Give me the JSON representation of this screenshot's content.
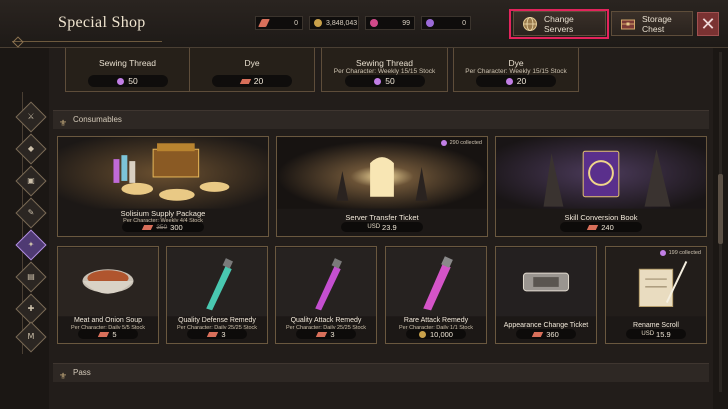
{
  "header": {
    "title": "Special Shop",
    "currencies": [
      {
        "icon": "red-gem-icon",
        "value": "0",
        "color": "#d86f5a"
      },
      {
        "icon": "gold-coin-icon",
        "value": "3,848,043",
        "color": "#c9a14a"
      },
      {
        "icon": "pink-gem-icon",
        "value": "99",
        "color": "#d24a8a"
      },
      {
        "icon": "purple-orb-icon",
        "value": "0",
        "color": "#9b6ad8"
      }
    ],
    "change_servers_label": "Change Servers",
    "storage_chest_label": "Storage Chest"
  },
  "top_row": [
    {
      "name": "Sewing Thread",
      "sub": "",
      "price": "50",
      "currency": "pink-orb"
    },
    {
      "name": "Dye",
      "sub": "",
      "price": "20",
      "currency": "red-gem"
    },
    {
      "name": "Sewing Thread",
      "sub": "Per Character:  Weekly 15/15 Stock",
      "price": "50",
      "currency": "pink-orb"
    },
    {
      "name": "Dye",
      "sub": "Per Character:  Weekly 15/15 Stock",
      "price": "20",
      "currency": "pink-orb"
    }
  ],
  "sections": {
    "consumables": "Consumables",
    "pass": "Pass"
  },
  "consumables_row1": [
    {
      "name": "Solisium Supply Package",
      "sub": "Per Character:  Weekly 4/4 Stock",
      "old_price": "350",
      "price": "300",
      "currency": "red-gem"
    },
    {
      "name": "Server Transfer Ticket",
      "sub": "",
      "collected": "290 collected",
      "unit": "USD",
      "price": "23.9"
    },
    {
      "name": "Skill Conversion Book",
      "sub": "",
      "price": "240",
      "currency": "red-gem"
    }
  ],
  "consumables_row2": [
    {
      "name": "Meat and Onion Soup",
      "sub": "Per Character:  Daily 5/5 Stock",
      "price": "5",
      "currency": "red-gem"
    },
    {
      "name": "Quality Defense Remedy",
      "sub": "Per Character:  Daily 25/25 Stock",
      "price": "3",
      "currency": "red-gem"
    },
    {
      "name": "Quality Attack Remedy",
      "sub": "Per Character:  Daily 25/25 Stock",
      "price": "3",
      "currency": "red-gem"
    },
    {
      "name": "Rare Attack Remedy",
      "sub": "Per Character:  Daily 1/1 Stock",
      "price": "10,000",
      "currency": "gold-coin"
    },
    {
      "name": "Appearance Change Ticket",
      "sub": "",
      "price": "360",
      "currency": "red-gem"
    },
    {
      "name": "Rename Scroll",
      "sub": "",
      "collected": "199 collected",
      "unit": "USD",
      "price": "15.9"
    }
  ],
  "sidebar": [
    {
      "icon": "sword-icon",
      "active": false
    },
    {
      "icon": "armor-icon",
      "active": false
    },
    {
      "icon": "chest-icon",
      "active": false
    },
    {
      "icon": "scroll-icon",
      "active": false
    },
    {
      "icon": "potion-icon",
      "active": true
    },
    {
      "icon": "wardrobe-icon",
      "active": false
    },
    {
      "icon": "emblem-icon",
      "active": false
    },
    {
      "icon": "mount-icon",
      "active": false
    }
  ]
}
